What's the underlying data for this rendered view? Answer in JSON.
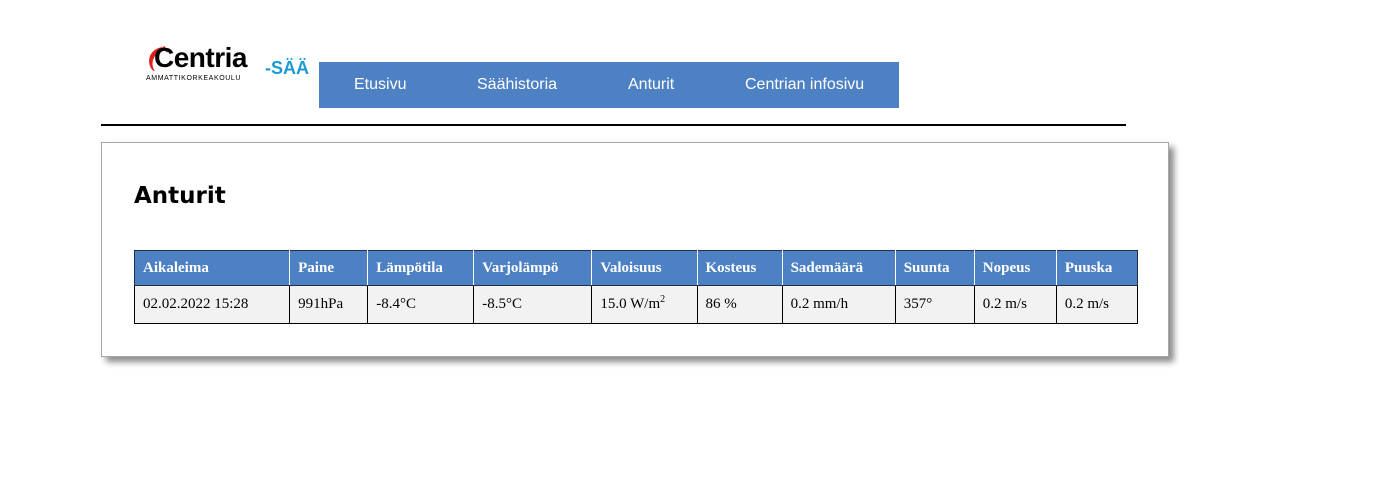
{
  "logo": {
    "main": "Centria",
    "suffix": "-SÄÄ",
    "sub": "AMMATTIKORKEAKOULU",
    "accent_color": "#e0201b",
    "suffix_color": "#1a9ad6"
  },
  "nav": {
    "background": "#4e81c4",
    "items": [
      {
        "label": "Etusivu"
      },
      {
        "label": "Säähistoria"
      },
      {
        "label": "Anturit"
      },
      {
        "label": "Centrian infosivu"
      }
    ]
  },
  "page": {
    "title": "Anturit"
  },
  "sensor_table": {
    "headers": [
      "Aikaleima",
      "Paine",
      "Lämpötila",
      "Varjolämpö",
      "Valoisuus",
      "Kosteus",
      "Sademäärä",
      "Suunta",
      "Nopeus",
      "Puuska"
    ],
    "row": {
      "timestamp": "02.02.2022 15:28",
      "pressure": "991hPa",
      "temperature": "-8.4°C",
      "shade_temperature": "-8.5°C",
      "light_value": "15.0 W/m",
      "light_unit_sup": "2",
      "humidity": "86 %",
      "rainfall": "0.2 mm/h",
      "direction": "357°",
      "speed": "0.2 m/s",
      "gust": "0.2 m/s"
    }
  }
}
